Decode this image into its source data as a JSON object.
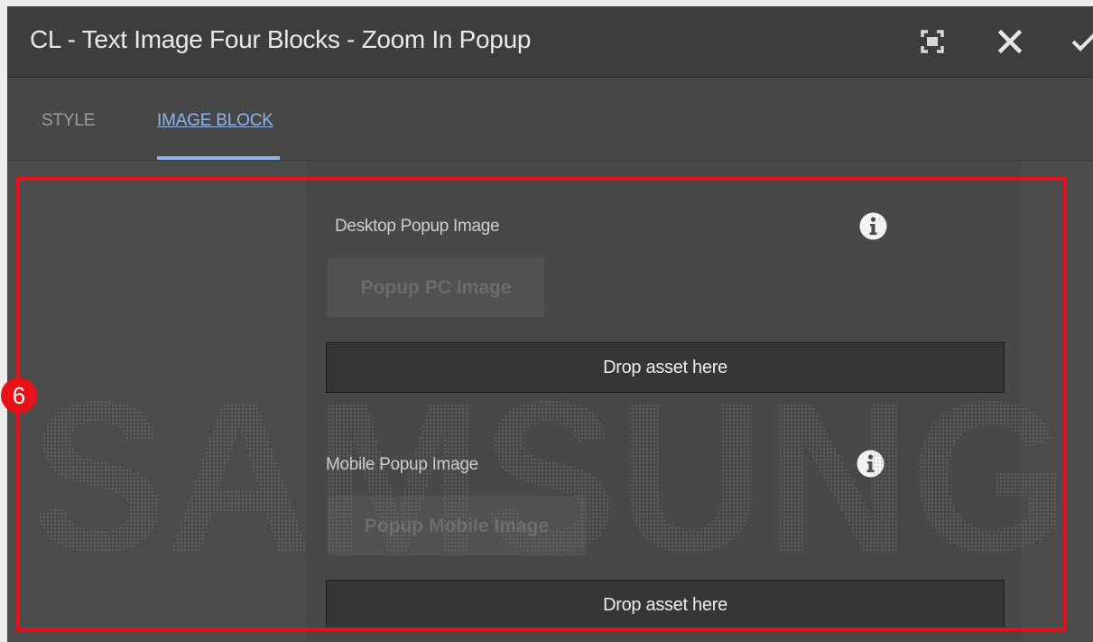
{
  "dialog": {
    "title": "CL - Text Image Four Blocks - Zoom In Popup",
    "actions": {
      "fullscreen_icon": "fullscreen-icon",
      "close_icon": "close-icon",
      "done_icon": "checkmark-icon"
    }
  },
  "tabs": [
    {
      "label": "STYLE",
      "selected": false
    },
    {
      "label": "IMAGE BLOCK",
      "selected": true
    }
  ],
  "fields": {
    "desktop": {
      "label": "Desktop Popup Image",
      "pick_button": "Popup PC Image",
      "drop_text": "Drop asset here",
      "info_icon": "info-icon"
    },
    "mobile": {
      "label": "Mobile Popup Image",
      "pick_button": "Popup Mobile Image",
      "drop_text": "Drop asset here",
      "info_icon": "info-icon"
    }
  },
  "annotation": {
    "number": "6",
    "color": "#e5121a"
  },
  "watermark": {
    "text": "SAMSUNG"
  },
  "colors": {
    "tab_active": "#8fb4e8",
    "background": "#4b4b4b",
    "title_bar": "#3d3d3d"
  }
}
